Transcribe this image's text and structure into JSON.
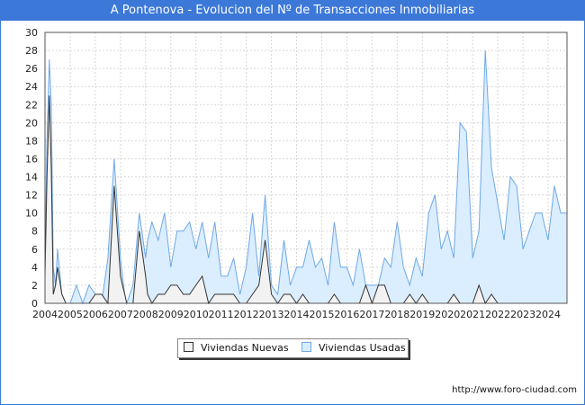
{
  "title": "A Pontenova - Evolucion del Nº de Transacciones Inmobiliarias",
  "source": "http://www.foro-ciudad.com",
  "colors": {
    "title_bg": "#3c78d8",
    "usadas_fill": "#dbeeff",
    "usadas_line": "#6fa8e8",
    "nuevas_fill": "#f2f2f2",
    "nuevas_line": "#333333"
  },
  "chart_data": {
    "type": "area",
    "title": "A Pontenova - Evolucion del Nº de Transacciones Inmobiliarias",
    "xlabel": "",
    "ylabel": "",
    "ylim": [
      0,
      30
    ],
    "yticks": [
      0,
      2,
      4,
      6,
      8,
      10,
      12,
      14,
      16,
      18,
      20,
      22,
      24,
      26,
      28,
      30
    ],
    "xticks": [
      "2004",
      "2005",
      "2006",
      "2007",
      "2008",
      "2009",
      "2010",
      "2011",
      "2012",
      "2013",
      "2014",
      "2015",
      "2016",
      "2017",
      "2018",
      "2019",
      "2020",
      "2021",
      "2022",
      "2023",
      "2024"
    ],
    "xlim": [
      2004,
      2024.75
    ],
    "grid": true,
    "legend_position": "bottom",
    "series": [
      {
        "name": "Viviendas Usadas",
        "x": [
          2004,
          2004.08,
          2004.17,
          2004.25,
          2004.33,
          2004.42,
          2004.5,
          2004.67,
          2004.83,
          2005,
          2005.25,
          2005.5,
          2005.75,
          2006,
          2006.25,
          2006.5,
          2006.75,
          2007,
          2007.08,
          2007.17,
          2007.25,
          2007.5,
          2007.75,
          2008,
          2008.08,
          2008.25,
          2008.5,
          2008.75,
          2009,
          2009.25,
          2009.5,
          2009.75,
          2010,
          2010.25,
          2010.5,
          2010.75,
          2011,
          2011.25,
          2011.5,
          2011.75,
          2012,
          2012.25,
          2012.5,
          2012.75,
          2013,
          2013.25,
          2013.5,
          2013.75,
          2014,
          2014.25,
          2014.5,
          2014.75,
          2015,
          2015.25,
          2015.5,
          2015.75,
          2016,
          2016.25,
          2016.5,
          2016.75,
          2017,
          2017.25,
          2017.5,
          2017.75,
          2018,
          2018.25,
          2018.5,
          2018.75,
          2019,
          2019.25,
          2019.5,
          2019.75,
          2020,
          2020.25,
          2020.5,
          2020.75,
          2021,
          2021.25,
          2021.5,
          2021.75,
          2022,
          2022.25,
          2022.5,
          2022.75,
          2023,
          2023.25,
          2023.5,
          2023.75,
          2024,
          2024.25,
          2024.5,
          2024.75
        ],
        "y": [
          4,
          18,
          27,
          22,
          4,
          2,
          6,
          1,
          0,
          0,
          2,
          0,
          2,
          1,
          0,
          5,
          16,
          5,
          3,
          1,
          0,
          2,
          10,
          5,
          7,
          9,
          7,
          10,
          4,
          8,
          8,
          9,
          6,
          9,
          5,
          9,
          3,
          3,
          5,
          1,
          4,
          10,
          3,
          12,
          2,
          1,
          7,
          2,
          4,
          4,
          7,
          4,
          5,
          2,
          9,
          4,
          4,
          2,
          6,
          2,
          2,
          2,
          5,
          4,
          9,
          4,
          2,
          5,
          3,
          10,
          12,
          6,
          8,
          5,
          20,
          19,
          5,
          8,
          28,
          15,
          11,
          7,
          14,
          13,
          6,
          8,
          10,
          10,
          7,
          13,
          10,
          10
        ]
      },
      {
        "name": "Viviendas Nuevas",
        "x": [
          2004,
          2004.08,
          2004.17,
          2004.25,
          2004.33,
          2004.42,
          2004.5,
          2004.67,
          2004.83,
          2005,
          2005.25,
          2005.5,
          2005.75,
          2006,
          2006.25,
          2006.5,
          2006.75,
          2007,
          2007.08,
          2007.17,
          2007.25,
          2007.5,
          2007.75,
          2008,
          2008.08,
          2008.25,
          2008.5,
          2008.75,
          2009,
          2009.25,
          2009.5,
          2009.75,
          2010,
          2010.25,
          2010.5,
          2010.75,
          2011,
          2011.25,
          2011.5,
          2011.75,
          2012,
          2012.25,
          2012.5,
          2012.75,
          2013,
          2013.25,
          2013.5,
          2013.75,
          2014,
          2014.25,
          2014.5,
          2014.75,
          2015,
          2015.25,
          2015.5,
          2015.75,
          2016,
          2016.25,
          2016.5,
          2016.75,
          2017,
          2017.25,
          2017.5,
          2017.75,
          2018,
          2018.25,
          2018.5,
          2018.75,
          2019,
          2019.25,
          2019.5,
          2019.75,
          2020,
          2020.25,
          2020.5,
          2020.75,
          2021,
          2021.25,
          2021.5,
          2021.75,
          2022,
          2022.25,
          2022.5,
          2022.75,
          2023,
          2023.25,
          2023.5,
          2023.75,
          2024,
          2024.25,
          2024.5,
          2024.75
        ],
        "y": [
          3,
          14,
          23,
          15,
          1,
          2,
          4,
          1,
          0,
          0,
          0,
          0,
          0,
          1,
          1,
          0,
          13,
          3,
          2,
          1,
          0,
          0,
          8,
          3,
          1,
          0,
          1,
          1,
          2,
          2,
          1,
          1,
          2,
          3,
          0,
          1,
          1,
          1,
          1,
          0,
          0,
          1,
          2,
          7,
          1,
          0,
          1,
          1,
          0,
          1,
          0,
          0,
          0,
          0,
          1,
          0,
          0,
          0,
          0,
          2,
          0,
          2,
          2,
          0,
          0,
          0,
          1,
          0,
          1,
          0,
          0,
          0,
          0,
          1,
          0,
          0,
          0,
          2,
          0,
          1,
          0,
          0,
          0,
          0,
          0,
          0,
          0,
          0,
          0,
          0,
          0,
          0
        ]
      }
    ]
  }
}
